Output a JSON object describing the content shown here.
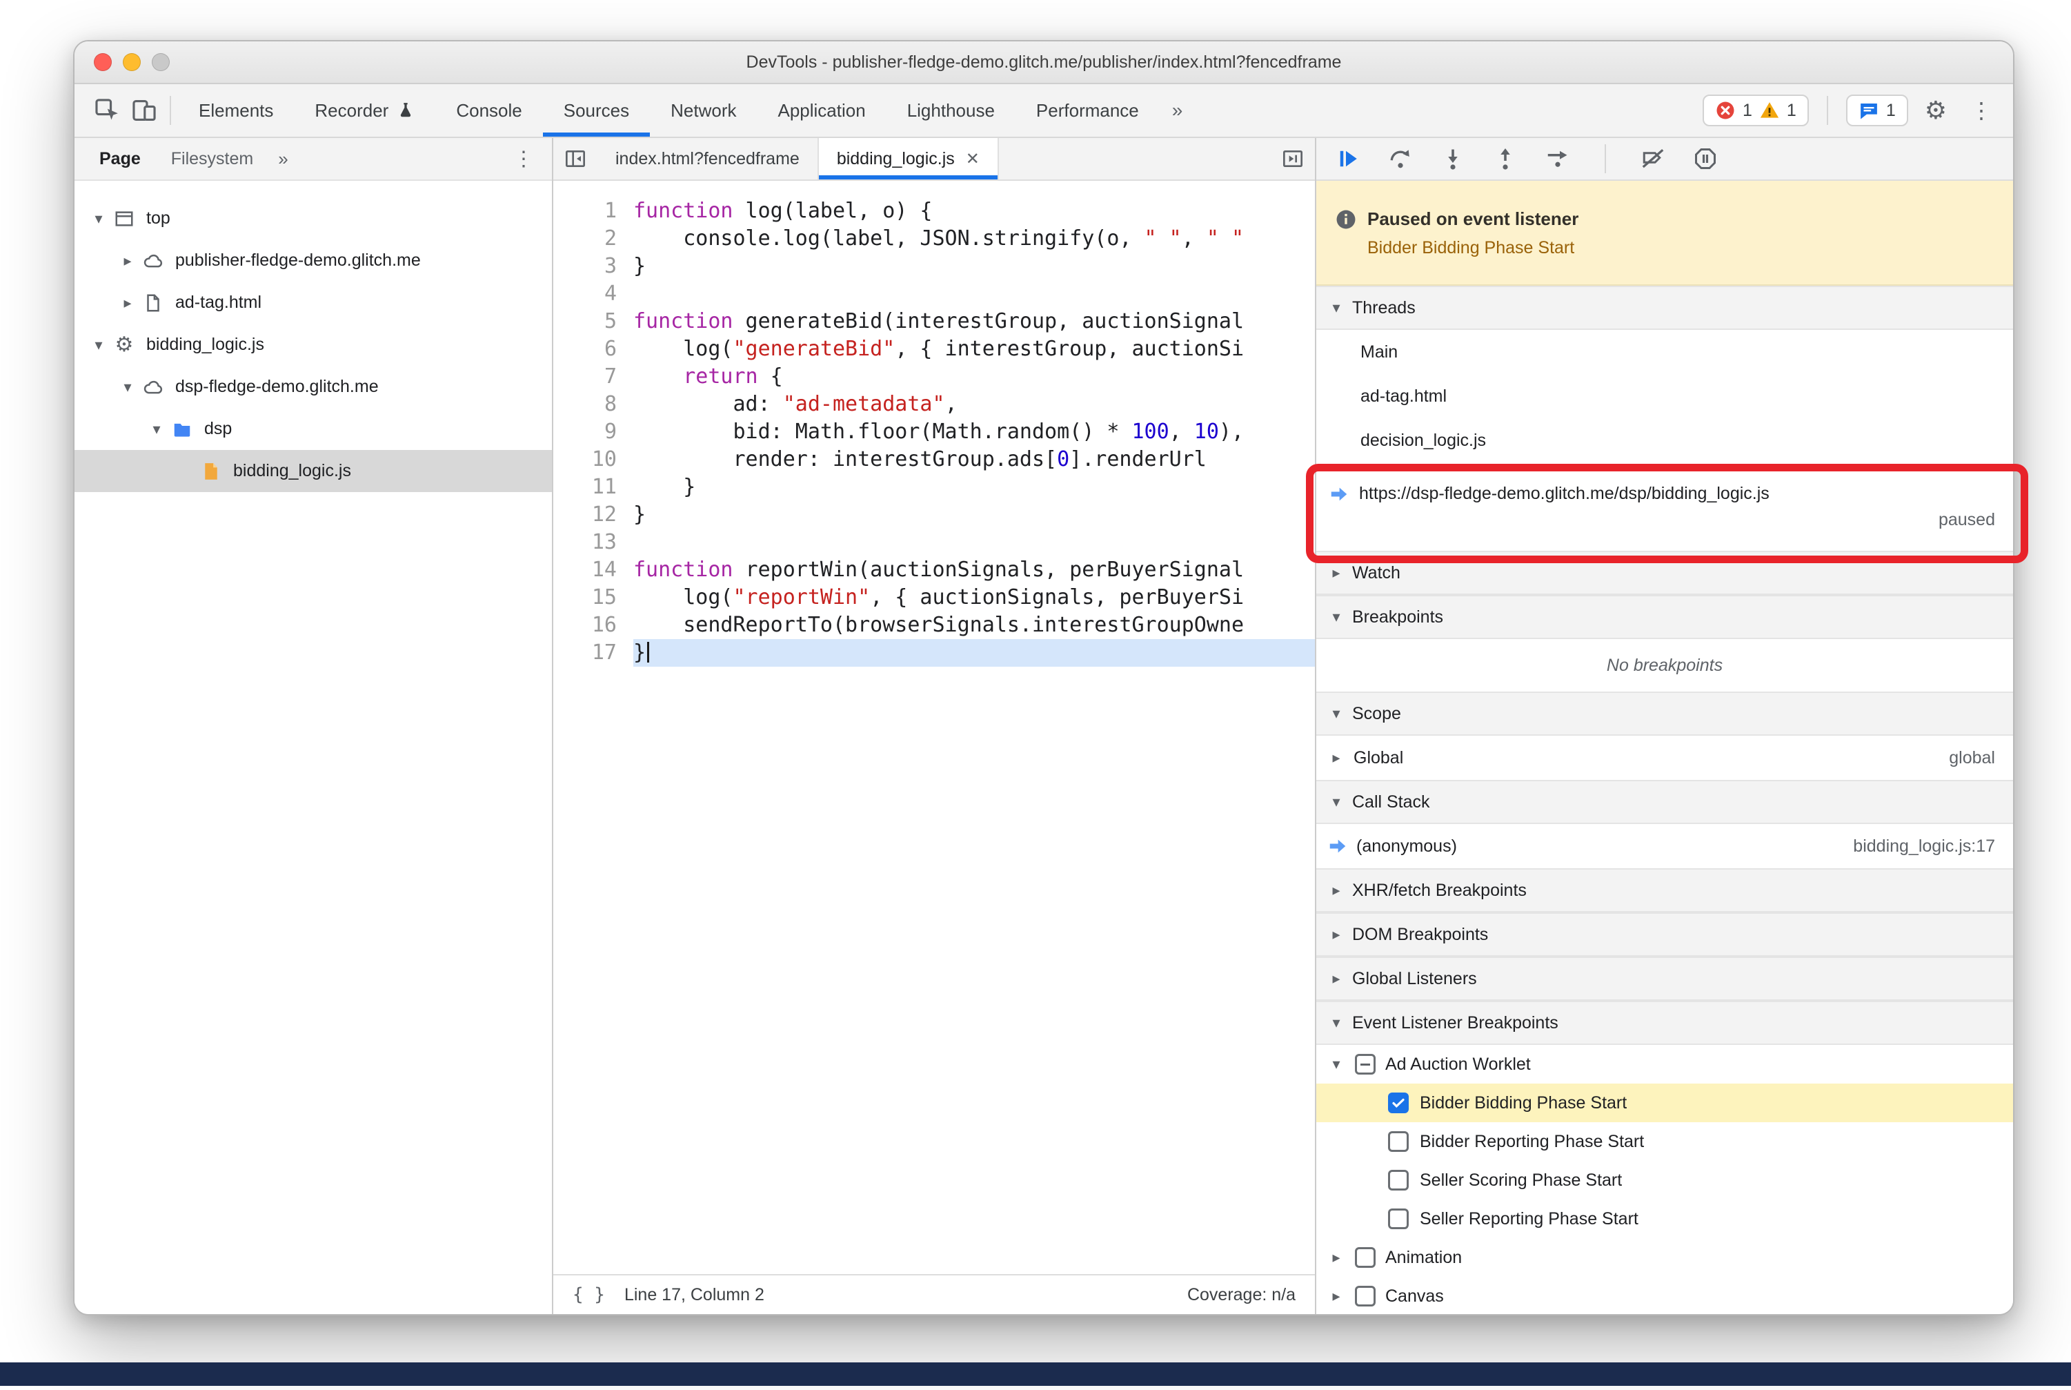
{
  "colors": {
    "accent": "#1a73e8",
    "error": "#e5443b",
    "warning": "#f2a60d",
    "annotation": "#e8232a",
    "banner_bg": "#fdf2cd",
    "banner_detail": "#9a6209",
    "exec_line": "#d5e6fb",
    "selection": "#d8d8d8",
    "elb_highlight": "#fdf3bd",
    "bottom_bar": "#1b2b4e",
    "code_keyword": "#a626a4",
    "code_string": "#c5221f",
    "code_number": "#1c00cf"
  },
  "glyphs": {
    "arrow_down": "▾",
    "arrow_right": "▸",
    "chevrons": "»",
    "kebab": "⋮",
    "gear": "⚙",
    "close": "✕",
    "brace": "{ }"
  },
  "window": {
    "title": "DevTools - publisher-fledge-demo.glitch.me/publisher/index.html?fencedframe"
  },
  "toolbar": {
    "tabs": [
      {
        "label": "Elements"
      },
      {
        "label": "Recorder",
        "icon": "flask"
      },
      {
        "label": "Console"
      },
      {
        "label": "Sources",
        "active": true
      },
      {
        "label": "Network"
      },
      {
        "label": "Application"
      },
      {
        "label": "Lighthouse"
      },
      {
        "label": "Performance"
      }
    ],
    "error_count": "1",
    "warning_count": "1",
    "issues_count": "1"
  },
  "navigator": {
    "tabs": [
      {
        "label": "Page",
        "active": true
      },
      {
        "label": "Filesystem"
      }
    ],
    "tree": [
      {
        "label": "top",
        "icon": "frame",
        "arrow": "down",
        "level": 0
      },
      {
        "label": "publisher-fledge-demo.glitch.me",
        "icon": "cloud",
        "arrow": "right",
        "level": 1
      },
      {
        "label": "ad-tag.html",
        "icon": "document",
        "arrow": "right",
        "level": 1
      },
      {
        "label": "bidding_logic.js",
        "icon": "gear",
        "arrow": "down",
        "level": 0
      },
      {
        "label": "dsp-fledge-demo.glitch.me",
        "icon": "cloud",
        "arrow": "down",
        "level": 1
      },
      {
        "label": "dsp",
        "icon": "folder",
        "arrow": "down",
        "level": 2
      },
      {
        "label": "bidding_logic.js",
        "icon": "file-yellow",
        "arrow": "none",
        "level": 3,
        "selected": true
      }
    ]
  },
  "editor": {
    "tabs": [
      {
        "label": "index.html?fencedframe"
      },
      {
        "label": "bidding_logic.js",
        "active": true
      }
    ],
    "lines": [
      {
        "n": 1,
        "t": [
          [
            "kw",
            "function"
          ],
          [
            "pl",
            " log(label, o) {"
          ]
        ]
      },
      {
        "n": 2,
        "t": [
          [
            "pl",
            "    console.log(label, JSON.stringify(o, "
          ],
          [
            "str",
            "\" \""
          ],
          [
            "pl",
            ", "
          ],
          [
            "str",
            "\" \""
          ]
        ]
      },
      {
        "n": 3,
        "t": [
          [
            "pl",
            "}"
          ]
        ]
      },
      {
        "n": 4,
        "t": []
      },
      {
        "n": 5,
        "t": [
          [
            "kw",
            "function"
          ],
          [
            "pl",
            " generateBid(interestGroup, auctionSignal"
          ]
        ]
      },
      {
        "n": 6,
        "t": [
          [
            "pl",
            "    log("
          ],
          [
            "str",
            "\"generateBid\""
          ],
          [
            "pl",
            ", { interestGroup, auctionSi"
          ]
        ]
      },
      {
        "n": 7,
        "t": [
          [
            "pl",
            "    "
          ],
          [
            "kw",
            "return"
          ],
          [
            "pl",
            " {"
          ]
        ]
      },
      {
        "n": 8,
        "t": [
          [
            "pl",
            "        ad: "
          ],
          [
            "str",
            "\"ad-metadata\""
          ],
          [
            "pl",
            ","
          ]
        ]
      },
      {
        "n": 9,
        "t": [
          [
            "pl",
            "        bid: Math.floor(Math.random() * "
          ],
          [
            "num",
            "100"
          ],
          [
            "pl",
            ", "
          ],
          [
            "num",
            "10"
          ],
          [
            "pl",
            "),"
          ]
        ]
      },
      {
        "n": 10,
        "t": [
          [
            "pl",
            "        render: interestGroup.ads["
          ],
          [
            "num",
            "0"
          ],
          [
            "pl",
            "].renderUrl"
          ]
        ]
      },
      {
        "n": 11,
        "t": [
          [
            "pl",
            "    }"
          ]
        ]
      },
      {
        "n": 12,
        "t": [
          [
            "pl",
            "}"
          ]
        ]
      },
      {
        "n": 13,
        "t": []
      },
      {
        "n": 14,
        "t": [
          [
            "kw",
            "function"
          ],
          [
            "pl",
            " reportWin(auctionSignals, perBuyerSignal"
          ]
        ]
      },
      {
        "n": 15,
        "t": [
          [
            "pl",
            "    log("
          ],
          [
            "str",
            "\"reportWin\""
          ],
          [
            "pl",
            ", { auctionSignals, perBuyerSi"
          ]
        ]
      },
      {
        "n": 16,
        "t": [
          [
            "pl",
            "    sendReportTo(browserSignals.interestGroupOwne"
          ]
        ]
      },
      {
        "n": 17,
        "t": [
          [
            "pl",
            "}"
          ]
        ],
        "exec": true
      }
    ],
    "status": {
      "line_col": "Line 17, Column 2",
      "coverage": "Coverage: n/a"
    }
  },
  "debugger": {
    "toolbar_icons": [
      "resume",
      "step-over",
      "step-into",
      "step-out",
      "step",
      "deactivate-breakpoints",
      "pause-on-exceptions"
    ],
    "banner": {
      "title": "Paused on event listener",
      "detail": "Bidder Bidding Phase Start"
    },
    "threads": {
      "header": "Threads",
      "items": [
        {
          "label": "Main"
        },
        {
          "label": "ad-tag.html"
        },
        {
          "label": "decision_logic.js"
        },
        {
          "label": "https://dsp-fledge-demo.glitch.me/dsp/bidding_logic.js",
          "active": true,
          "status": "paused"
        }
      ]
    },
    "watch": {
      "header": "Watch"
    },
    "breakpoints": {
      "header": "Breakpoints",
      "empty": "No breakpoints"
    },
    "scope": {
      "header": "Scope",
      "rows": [
        {
          "label": "Global",
          "value": "global"
        }
      ]
    },
    "callstack": {
      "header": "Call Stack",
      "frames": [
        {
          "label": "(anonymous)",
          "location": "bidding_logic.js:17",
          "current": true
        }
      ]
    },
    "collapsed": [
      "XHR/fetch Breakpoints",
      "DOM Breakpoints",
      "Global Listeners"
    ],
    "elb": {
      "header": "Event Listener Breakpoints",
      "groups": [
        {
          "label": "Ad Auction Worklet",
          "state": "indeterminate",
          "expanded": true,
          "children": [
            {
              "label": "Bidder Bidding Phase Start",
              "checked": true,
              "highlight": true
            },
            {
              "label": "Bidder Reporting Phase Start",
              "checked": false
            },
            {
              "label": "Seller Scoring Phase Start",
              "checked": false
            },
            {
              "label": "Seller Reporting Phase Start",
              "checked": false
            }
          ]
        },
        {
          "label": "Animation",
          "state": "unchecked",
          "expanded": false
        },
        {
          "label": "Canvas",
          "state": "unchecked",
          "expanded": false
        }
      ]
    }
  }
}
